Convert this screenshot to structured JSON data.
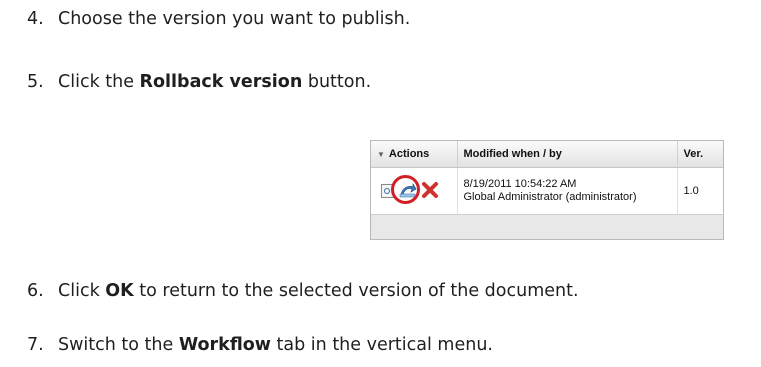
{
  "steps": [
    {
      "num": "4.",
      "before": "Choose the version you want to publish.",
      "bold": "",
      "after": ""
    },
    {
      "num": "5.",
      "before": "Click the ",
      "bold": "Rollback version",
      "after": " button."
    },
    {
      "num": "6.",
      "before": "Click ",
      "bold": "OK",
      "after": " to return to the selected version of the document."
    },
    {
      "num": "7.",
      "before": "Switch to the ",
      "bold": "Workflow",
      "after": " tab in the vertical menu."
    }
  ],
  "version_table": {
    "headers": {
      "actions": "Actions",
      "modified": "Modified when / by",
      "version": "Ver."
    },
    "rows": [
      {
        "modified_when": "8/19/2011 10:54:22 AM",
        "modified_by": "Global Administrator (administrator)",
        "version": "1.0"
      }
    ],
    "icons": [
      "view-icon",
      "rollback-icon",
      "delete-icon"
    ],
    "highlight_color": "#d21f26"
  }
}
